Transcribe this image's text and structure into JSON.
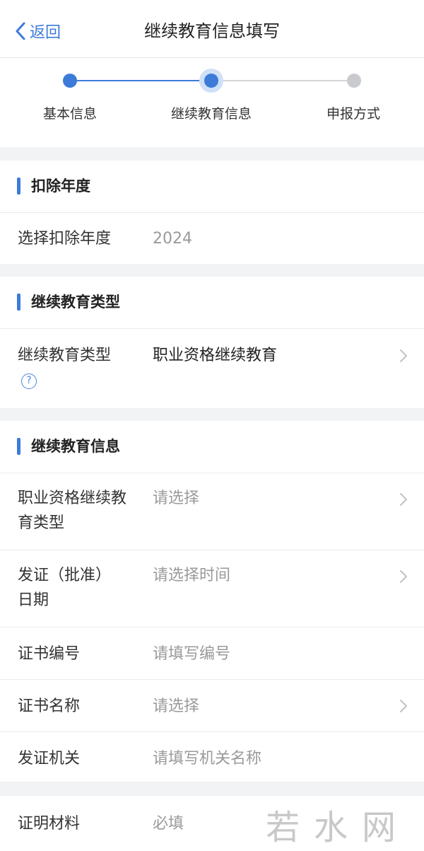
{
  "nav": {
    "back_label": "返回",
    "title": "继续教育信息填写"
  },
  "stepper": {
    "steps": [
      {
        "label": "基本信息",
        "state": "done"
      },
      {
        "label": "继续教育信息",
        "state": "current"
      },
      {
        "label": "申报方式",
        "state": "todo"
      }
    ]
  },
  "sections": {
    "deduction_year": {
      "title": "扣除年度",
      "rows": [
        {
          "label": "选择扣除年度",
          "value": "2024"
        }
      ]
    },
    "education_type": {
      "title": "继续教育类型",
      "rows": [
        {
          "label": "继续教育类型",
          "value": "职业资格继续教育",
          "help_icon": "?"
        }
      ]
    },
    "education_info": {
      "title": "继续教育信息",
      "rows": [
        {
          "label": "职业资格继续教育类型",
          "placeholder": "请选择"
        },
        {
          "label": "发证（批准）日期",
          "placeholder": "请选择时间"
        },
        {
          "label": "证书编号",
          "placeholder": "请填写编号"
        },
        {
          "label": "证书名称",
          "placeholder": "请选择"
        },
        {
          "label": "发证机关",
          "placeholder": "请填写机关名称"
        }
      ]
    },
    "proof": {
      "rows": [
        {
          "label": "证明材料",
          "placeholder": "必填"
        }
      ]
    }
  },
  "watermark": "若水网",
  "colors": {
    "accent": "#3d7bd9",
    "background": "#f2f3f5",
    "placeholder": "#9a9a9a",
    "step_todo": "#c9cacd"
  }
}
